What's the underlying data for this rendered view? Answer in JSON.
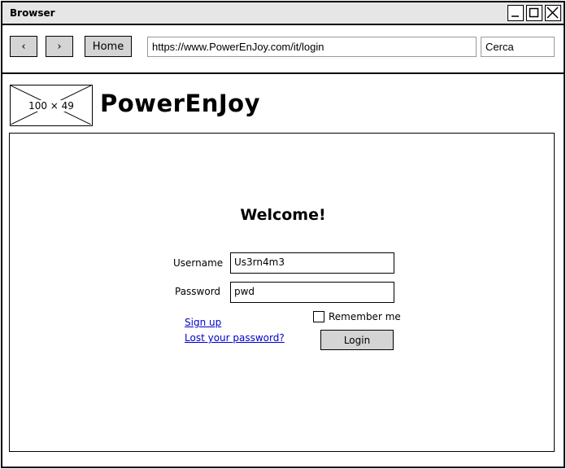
{
  "window": {
    "title": "Browser"
  },
  "toolbar": {
    "back_label": "‹",
    "forward_label": "›",
    "home_label": "Home",
    "url": "https://www.PowerEnJoy.com/it/login",
    "search_placeholder": "Cerca"
  },
  "header": {
    "logo_placeholder": "100 × 49",
    "brand": "PowerEnJoy"
  },
  "login": {
    "welcome": "Welcome!",
    "username_label": "Username",
    "username_value": "Us3rn4m3",
    "password_label": "Password",
    "password_value": "pwd",
    "remember_label": "Remember me",
    "remember_checked": false,
    "signup_link": "Sign up",
    "lost_password_link": "Lost your password?",
    "login_button": "Login"
  },
  "icons": {
    "minimize": "minimize-icon",
    "maximize": "maximize-icon",
    "close": "close-icon",
    "logo": "image-placeholder-icon"
  },
  "colors": {
    "chrome": "#e6e6e6",
    "button": "#d4d4d4",
    "link": "#0000cc"
  }
}
